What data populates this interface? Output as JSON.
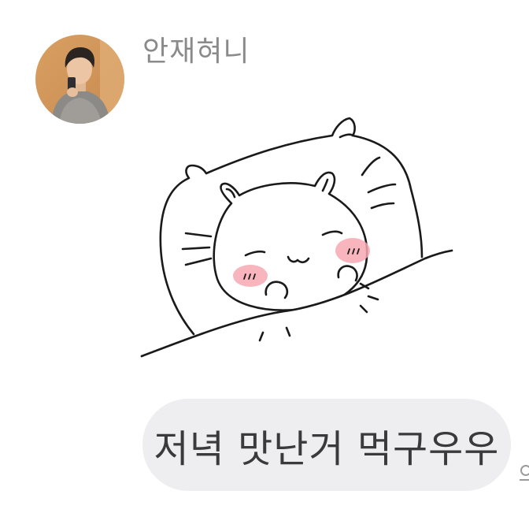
{
  "message": {
    "sender_name": "안재혀니",
    "avatar_icon": "profile-photo",
    "sticker_icon": "sleeping-cat-sticker",
    "text": "저녁 맛난거 먹구우우"
  },
  "colors": {
    "bubble_bg": "#eeeef0",
    "bubble_text": "#3a3a3c",
    "sender_name": "#8a8a8a",
    "blush": "#f7a8b2"
  }
}
